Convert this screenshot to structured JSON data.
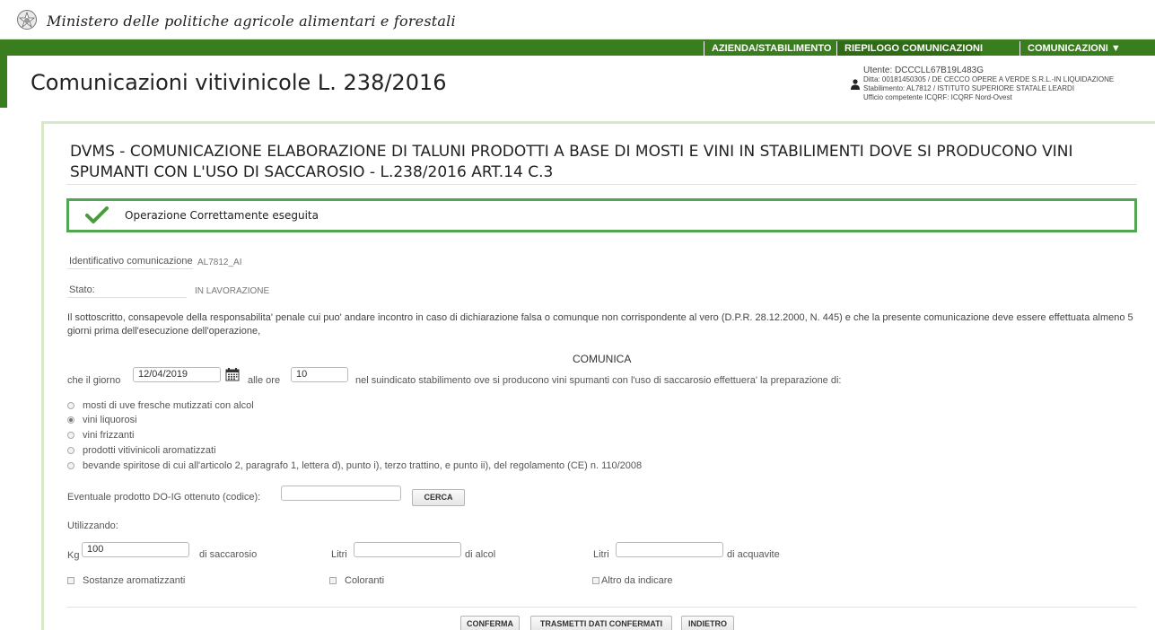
{
  "header": {
    "ministry": "Ministero delle politiche agricole alimentari e forestali",
    "app_title": "Comunicazioni vitivinicole L. 238/2016"
  },
  "nav": {
    "items": [
      {
        "label": "AZIENDA/STABILIMENTO"
      },
      {
        "label": "RIEPILOGO COMUNICAZIONI"
      },
      {
        "label": "COMUNICAZIONI ▼"
      }
    ]
  },
  "user": {
    "utente": "Utente: DCCCLL67B19L483G",
    "ditta": "Ditta: 00181450305 / DE CECCO OPERE A VERDE S.R.L.-IN LIQUIDAZIONE",
    "stabilimento": "Stabilimento: AL7812 / ISTITUTO SUPERIORE STATALE LEARDI",
    "ufficio": "Ufficio competente ICQRF: ICQRF Nord-Ovest"
  },
  "form": {
    "title": "DVMS - COMUNICAZIONE ELABORAZIONE DI TALUNI PRODOTTI A BASE DI MOSTI E VINI IN STABILIMENTI DOVE SI PRODUCONO VINI SPUMANTI CON L'USO DI SACCAROSIO - L.238/2016 ART.14 C.3",
    "success_message": "Operazione Correttamente eseguita",
    "identificativo_label": "Identificativo comunicazione",
    "identificativo_value": "AL7812_AI",
    "stato_label": "Stato:",
    "stato_value": "IN LAVORAZIONE",
    "declaration": "Il sottoscritto, consapevole della responsabilita' penale cui puo' andare incontro in caso di dichiarazione falsa o comunque non corrispondente al vero (D.P.R. 28.12.2000, N. 445) e che la presente comunicazione deve essere effettuata almeno 5 giorni prima dell'esecuzione dell'operazione,",
    "comunica": "COMUNICA",
    "giorno_prefix": "che il giorno",
    "giorno_value": "12/04/2019",
    "ore_label": "alle ore",
    "ore_value": "10",
    "sentence_rest": "nel suindicato stabilimento ove si producono vini spumanti con l'uso di saccarosio effettuera' la preparazione di:",
    "options": [
      {
        "label": "mosti di uve fresche mutizzati con alcol",
        "selected": false
      },
      {
        "label": "vini liquorosi",
        "selected": true
      },
      {
        "label": "vini frizzanti",
        "selected": false
      },
      {
        "label": "prodotti vitivinicoli aromatizzati",
        "selected": false
      },
      {
        "label": "bevande spiritose di cui all'articolo 2, paragrafo 1, lettera d), punto i), terzo trattino, e punto ii), del regolamento (CE) n. 110/2008",
        "selected": false
      }
    ],
    "prodotto_label": "Eventuale prodotto DO-IG ottenuto (codice):",
    "prodotto_value": "",
    "cerca_button": "CERCA",
    "utilizzando": "Utilizzando:",
    "kg_label": "Kg",
    "kg_value": "100",
    "saccarosio_label": "di saccarosio",
    "litri_label_1": "Litri",
    "alcol_value": "",
    "alcol_label": "di alcol",
    "litri_label_2": "Litri",
    "acquavite_value": "",
    "acquavite_label": "di acquavite",
    "checkboxes": [
      {
        "label": "Sostanze aromatizzanti"
      },
      {
        "label": "Coloranti"
      },
      {
        "label": "Altro da indicare"
      }
    ],
    "buttons": {
      "conferma": "CONFERMA",
      "trasmetti": "TRASMETTI DATI CONFERMATI",
      "indietro": "INDIETRO"
    }
  }
}
